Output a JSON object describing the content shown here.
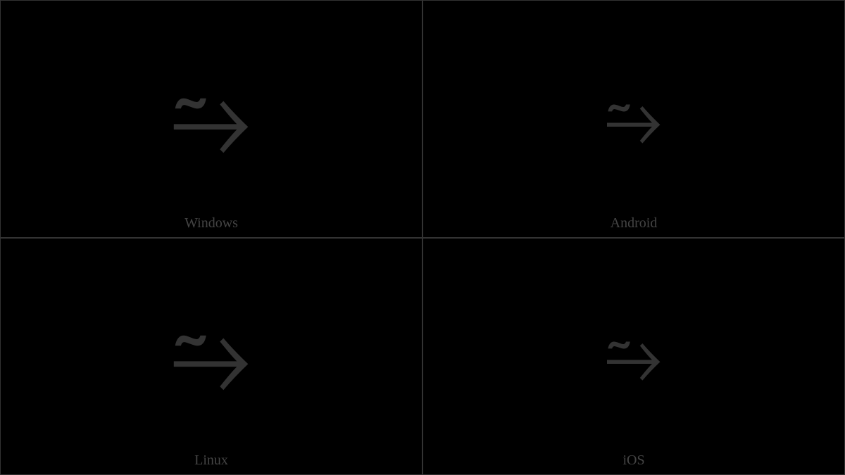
{
  "cells": [
    {
      "label": "Windows",
      "glyph": "⥲"
    },
    {
      "label": "Android",
      "glyph": "⥲"
    },
    {
      "label": "Linux",
      "glyph": "⥲"
    },
    {
      "label": "iOS",
      "glyph": "⥲"
    }
  ]
}
